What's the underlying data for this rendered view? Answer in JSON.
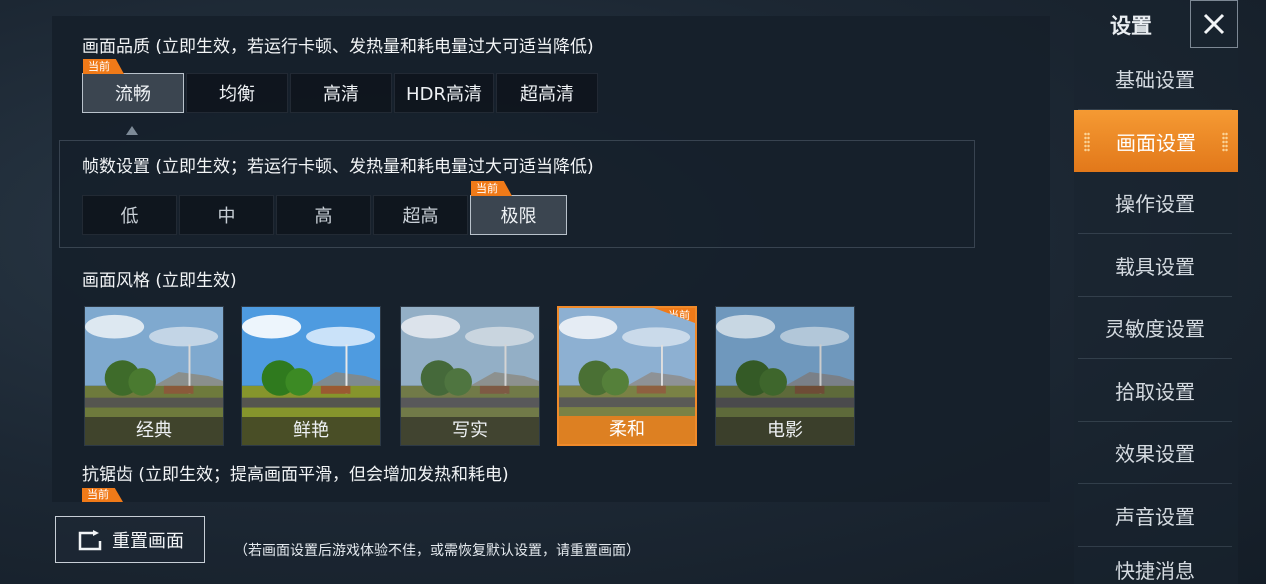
{
  "quality": {
    "title": "画面品质 (立即生效，若运行卡顿、发热量和耗电量过大可适当降低)",
    "options": [
      "流畅",
      "均衡",
      "高清",
      "HDR高清",
      "超高清"
    ],
    "selected_index": 0,
    "current_tag": "当前"
  },
  "fps": {
    "title": "帧数设置 (立即生效；若运行卡顿、发热量和耗电量过大可适当降低)",
    "options": [
      "低",
      "中",
      "高",
      "超高",
      "极限"
    ],
    "selected_index": 4,
    "current_tag": "当前"
  },
  "style": {
    "title": "画面风格 (立即生效)",
    "options": [
      "经典",
      "鲜艳",
      "写实",
      "柔和",
      "电影"
    ],
    "selected_index": 3,
    "current_tag": "当前"
  },
  "antialias": {
    "title": "抗锯齿 (立即生效；提高画面平滑，但会增加发热和耗电)",
    "current_tag": "当前"
  },
  "reset": {
    "label": "重置画面",
    "icon": "reset-icon",
    "hint": "（若画面设置后游戏体验不佳，或需恢复默认设置，请重置画面）"
  },
  "sidebar": {
    "title": "设置",
    "close_icon": "close-icon",
    "items": [
      {
        "label": "基础设置"
      },
      {
        "label": "画面设置",
        "active": true
      },
      {
        "label": "操作设置"
      },
      {
        "label": "载具设置"
      },
      {
        "label": "灵敏度设置"
      },
      {
        "label": "拾取设置"
      },
      {
        "label": "效果设置"
      },
      {
        "label": "声音设置"
      },
      {
        "label": "快捷消息"
      }
    ]
  },
  "colors": {
    "accent": "#f07a18",
    "active_tab": "#ec8a24",
    "panel_bg": "#161f2a"
  }
}
